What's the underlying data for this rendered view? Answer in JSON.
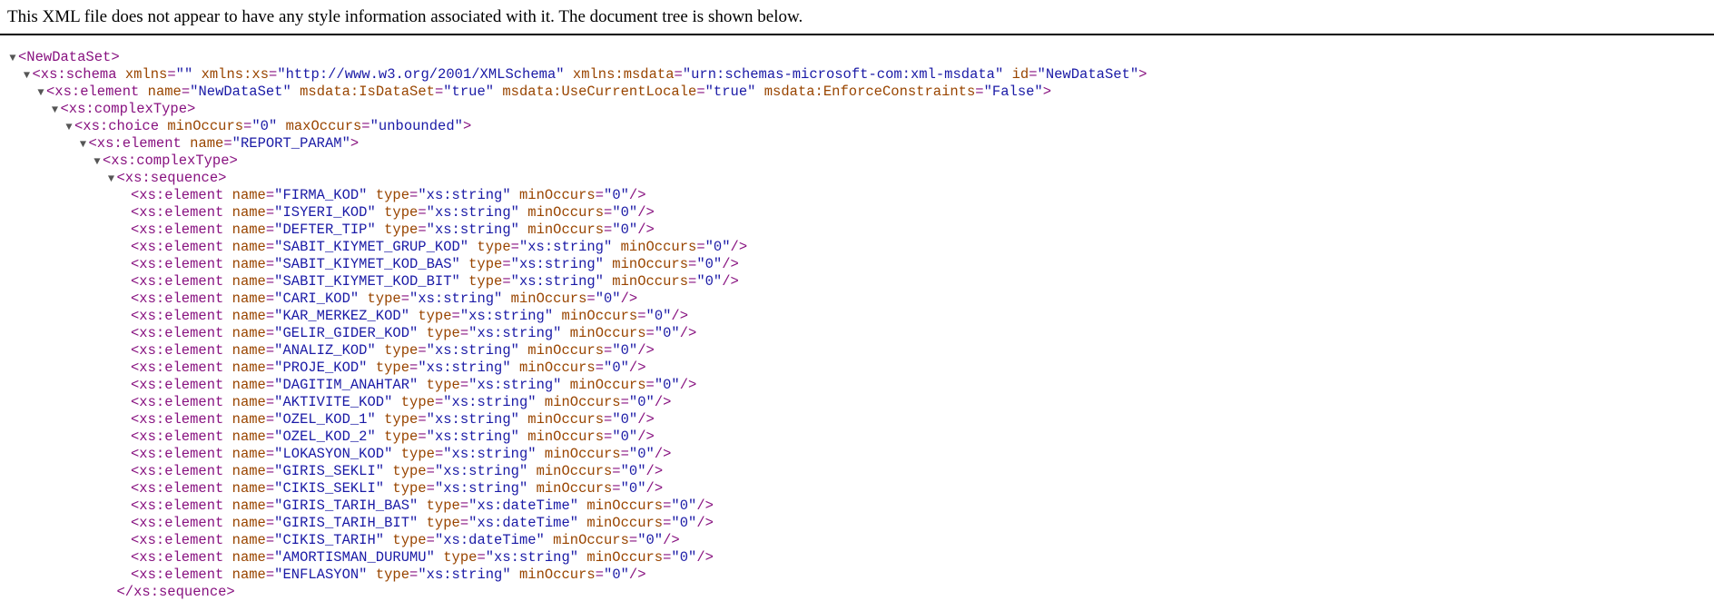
{
  "header": {
    "message": "This XML file does not appear to have any style information associated with it. The document tree is shown below."
  },
  "tree": {
    "toggle_glyph": "▼",
    "lines": [
      {
        "depth": 0,
        "toggle": true,
        "tag": "<NewDataSet",
        "close": ">",
        "attrs": []
      },
      {
        "depth": 1,
        "toggle": true,
        "tag": "<xs:schema",
        "close": ">",
        "attrs": [
          {
            "name": "xmlns",
            "value": "\"\""
          },
          {
            "name": "xmlns:xs",
            "value": "\"http://www.w3.org/2001/XMLSchema\""
          },
          {
            "name": "xmlns:msdata",
            "value": "\"urn:schemas-microsoft-com:xml-msdata\""
          },
          {
            "name": "id",
            "value": "\"NewDataSet\""
          }
        ]
      },
      {
        "depth": 2,
        "toggle": true,
        "tag": "<xs:element",
        "close": ">",
        "attrs": [
          {
            "name": "name",
            "value": "\"NewDataSet\""
          },
          {
            "name": "msdata:IsDataSet",
            "value": "\"true\""
          },
          {
            "name": "msdata:UseCurrentLocale",
            "value": "\"true\""
          },
          {
            "name": "msdata:EnforceConstraints",
            "value": "\"False\""
          }
        ]
      },
      {
        "depth": 3,
        "toggle": true,
        "tag": "<xs:complexType",
        "close": ">",
        "attrs": []
      },
      {
        "depth": 4,
        "toggle": true,
        "tag": "<xs:choice",
        "close": ">",
        "attrs": [
          {
            "name": "minOccurs",
            "value": "\"0\""
          },
          {
            "name": "maxOccurs",
            "value": "\"unbounded\""
          }
        ]
      },
      {
        "depth": 5,
        "toggle": true,
        "tag": "<xs:element",
        "close": ">",
        "attrs": [
          {
            "name": "name",
            "value": "\"REPORT_PARAM\""
          }
        ]
      },
      {
        "depth": 6,
        "toggle": true,
        "tag": "<xs:complexType",
        "close": ">",
        "attrs": []
      },
      {
        "depth": 7,
        "toggle": true,
        "tag": "<xs:sequence",
        "close": ">",
        "attrs": []
      },
      {
        "depth": 8,
        "toggle": false,
        "tag": "<xs:element",
        "close": "/>",
        "attrs": [
          {
            "name": "name",
            "value": "\"FIRMA_KOD\""
          },
          {
            "name": "type",
            "value": "\"xs:string\""
          },
          {
            "name": "minOccurs",
            "value": "\"0\""
          }
        ]
      },
      {
        "depth": 8,
        "toggle": false,
        "tag": "<xs:element",
        "close": "/>",
        "attrs": [
          {
            "name": "name",
            "value": "\"ISYERI_KOD\""
          },
          {
            "name": "type",
            "value": "\"xs:string\""
          },
          {
            "name": "minOccurs",
            "value": "\"0\""
          }
        ]
      },
      {
        "depth": 8,
        "toggle": false,
        "tag": "<xs:element",
        "close": "/>",
        "attrs": [
          {
            "name": "name",
            "value": "\"DEFTER_TIP\""
          },
          {
            "name": "type",
            "value": "\"xs:string\""
          },
          {
            "name": "minOccurs",
            "value": "\"0\""
          }
        ]
      },
      {
        "depth": 8,
        "toggle": false,
        "tag": "<xs:element",
        "close": "/>",
        "attrs": [
          {
            "name": "name",
            "value": "\"SABIT_KIYMET_GRUP_KOD\""
          },
          {
            "name": "type",
            "value": "\"xs:string\""
          },
          {
            "name": "minOccurs",
            "value": "\"0\""
          }
        ]
      },
      {
        "depth": 8,
        "toggle": false,
        "tag": "<xs:element",
        "close": "/>",
        "attrs": [
          {
            "name": "name",
            "value": "\"SABIT_KIYMET_KOD_BAS\""
          },
          {
            "name": "type",
            "value": "\"xs:string\""
          },
          {
            "name": "minOccurs",
            "value": "\"0\""
          }
        ]
      },
      {
        "depth": 8,
        "toggle": false,
        "tag": "<xs:element",
        "close": "/>",
        "attrs": [
          {
            "name": "name",
            "value": "\"SABIT_KIYMET_KOD_BIT\""
          },
          {
            "name": "type",
            "value": "\"xs:string\""
          },
          {
            "name": "minOccurs",
            "value": "\"0\""
          }
        ]
      },
      {
        "depth": 8,
        "toggle": false,
        "tag": "<xs:element",
        "close": "/>",
        "attrs": [
          {
            "name": "name",
            "value": "\"CARI_KOD\""
          },
          {
            "name": "type",
            "value": "\"xs:string\""
          },
          {
            "name": "minOccurs",
            "value": "\"0\""
          }
        ]
      },
      {
        "depth": 8,
        "toggle": false,
        "tag": "<xs:element",
        "close": "/>",
        "attrs": [
          {
            "name": "name",
            "value": "\"KAR_MERKEZ_KOD\""
          },
          {
            "name": "type",
            "value": "\"xs:string\""
          },
          {
            "name": "minOccurs",
            "value": "\"0\""
          }
        ]
      },
      {
        "depth": 8,
        "toggle": false,
        "tag": "<xs:element",
        "close": "/>",
        "attrs": [
          {
            "name": "name",
            "value": "\"GELIR_GIDER_KOD\""
          },
          {
            "name": "type",
            "value": "\"xs:string\""
          },
          {
            "name": "minOccurs",
            "value": "\"0\""
          }
        ]
      },
      {
        "depth": 8,
        "toggle": false,
        "tag": "<xs:element",
        "close": "/>",
        "attrs": [
          {
            "name": "name",
            "value": "\"ANALIZ_KOD\""
          },
          {
            "name": "type",
            "value": "\"xs:string\""
          },
          {
            "name": "minOccurs",
            "value": "\"0\""
          }
        ]
      },
      {
        "depth": 8,
        "toggle": false,
        "tag": "<xs:element",
        "close": "/>",
        "attrs": [
          {
            "name": "name",
            "value": "\"PROJE_KOD\""
          },
          {
            "name": "type",
            "value": "\"xs:string\""
          },
          {
            "name": "minOccurs",
            "value": "\"0\""
          }
        ]
      },
      {
        "depth": 8,
        "toggle": false,
        "tag": "<xs:element",
        "close": "/>",
        "attrs": [
          {
            "name": "name",
            "value": "\"DAGITIM_ANAHTAR\""
          },
          {
            "name": "type",
            "value": "\"xs:string\""
          },
          {
            "name": "minOccurs",
            "value": "\"0\""
          }
        ]
      },
      {
        "depth": 8,
        "toggle": false,
        "tag": "<xs:element",
        "close": "/>",
        "attrs": [
          {
            "name": "name",
            "value": "\"AKTIVITE_KOD\""
          },
          {
            "name": "type",
            "value": "\"xs:string\""
          },
          {
            "name": "minOccurs",
            "value": "\"0\""
          }
        ]
      },
      {
        "depth": 8,
        "toggle": false,
        "tag": "<xs:element",
        "close": "/>",
        "attrs": [
          {
            "name": "name",
            "value": "\"OZEL_KOD_1\""
          },
          {
            "name": "type",
            "value": "\"xs:string\""
          },
          {
            "name": "minOccurs",
            "value": "\"0\""
          }
        ]
      },
      {
        "depth": 8,
        "toggle": false,
        "tag": "<xs:element",
        "close": "/>",
        "attrs": [
          {
            "name": "name",
            "value": "\"OZEL_KOD_2\""
          },
          {
            "name": "type",
            "value": "\"xs:string\""
          },
          {
            "name": "minOccurs",
            "value": "\"0\""
          }
        ]
      },
      {
        "depth": 8,
        "toggle": false,
        "tag": "<xs:element",
        "close": "/>",
        "attrs": [
          {
            "name": "name",
            "value": "\"LOKASYON_KOD\""
          },
          {
            "name": "type",
            "value": "\"xs:string\""
          },
          {
            "name": "minOccurs",
            "value": "\"0\""
          }
        ]
      },
      {
        "depth": 8,
        "toggle": false,
        "tag": "<xs:element",
        "close": "/>",
        "attrs": [
          {
            "name": "name",
            "value": "\"GIRIS_SEKLI\""
          },
          {
            "name": "type",
            "value": "\"xs:string\""
          },
          {
            "name": "minOccurs",
            "value": "\"0\""
          }
        ]
      },
      {
        "depth": 8,
        "toggle": false,
        "tag": "<xs:element",
        "close": "/>",
        "attrs": [
          {
            "name": "name",
            "value": "\"CIKIS_SEKLI\""
          },
          {
            "name": "type",
            "value": "\"xs:string\""
          },
          {
            "name": "minOccurs",
            "value": "\"0\""
          }
        ]
      },
      {
        "depth": 8,
        "toggle": false,
        "tag": "<xs:element",
        "close": "/>",
        "attrs": [
          {
            "name": "name",
            "value": "\"GIRIS_TARIH_BAS\""
          },
          {
            "name": "type",
            "value": "\"xs:dateTime\""
          },
          {
            "name": "minOccurs",
            "value": "\"0\""
          }
        ]
      },
      {
        "depth": 8,
        "toggle": false,
        "tag": "<xs:element",
        "close": "/>",
        "attrs": [
          {
            "name": "name",
            "value": "\"GIRIS_TARIH_BIT\""
          },
          {
            "name": "type",
            "value": "\"xs:dateTime\""
          },
          {
            "name": "minOccurs",
            "value": "\"0\""
          }
        ]
      },
      {
        "depth": 8,
        "toggle": false,
        "tag": "<xs:element",
        "close": "/>",
        "attrs": [
          {
            "name": "name",
            "value": "\"CIKIS_TARIH\""
          },
          {
            "name": "type",
            "value": "\"xs:dateTime\""
          },
          {
            "name": "minOccurs",
            "value": "\"0\""
          }
        ]
      },
      {
        "depth": 8,
        "toggle": false,
        "tag": "<xs:element",
        "close": "/>",
        "attrs": [
          {
            "name": "name",
            "value": "\"AMORTISMAN_DURUMU\""
          },
          {
            "name": "type",
            "value": "\"xs:string\""
          },
          {
            "name": "minOccurs",
            "value": "\"0\""
          }
        ]
      },
      {
        "depth": 8,
        "toggle": false,
        "tag": "<xs:element",
        "close": "/>",
        "attrs": [
          {
            "name": "name",
            "value": "\"ENFLASYON\""
          },
          {
            "name": "type",
            "value": "\"xs:string\""
          },
          {
            "name": "minOccurs",
            "value": "\"0\""
          }
        ]
      },
      {
        "depth": 7,
        "toggle": false,
        "tag": "</xs:sequence",
        "close": ">",
        "attrs": []
      }
    ]
  }
}
